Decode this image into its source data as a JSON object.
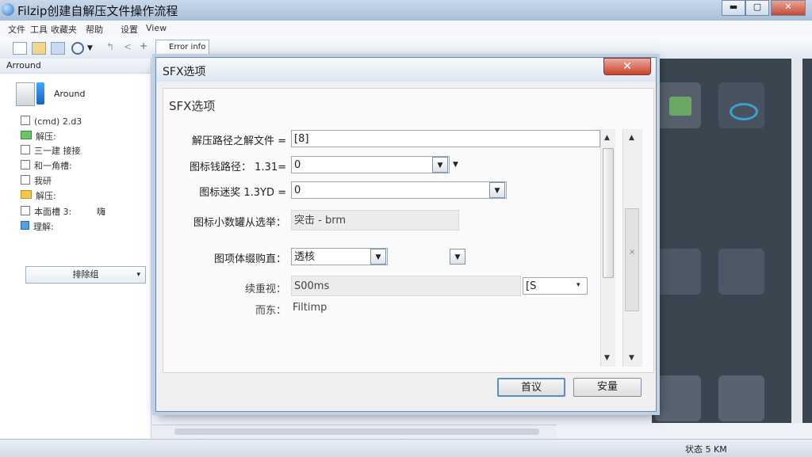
{
  "app": {
    "title": "Filzip创建自解压文件操作流程",
    "win_minimize": "▬",
    "win_maximize": "▢",
    "win_close": "✕"
  },
  "menu": [
    "文件",
    "工具",
    "收藏夹",
    "帮助",
    "设置",
    "View"
  ],
  "toolbar": {
    "info_label": "Error info"
  },
  "left_panel": {
    "header": "Arround",
    "drive_label": "Around",
    "tree": [
      {
        "label": "(cmd) 2.d3",
        "kind": "box"
      },
      {
        "label": "解压:",
        "kind": "folder"
      },
      {
        "label": "三一建 接接",
        "kind": "box"
      },
      {
        "label": "和一角槽:",
        "kind": "box"
      },
      {
        "label": "我研",
        "kind": "box"
      },
      {
        "label": "解压:",
        "kind": "folder"
      },
      {
        "label": "本面槽  3:",
        "kind": "box"
      },
      {
        "label": "理解:",
        "kind": "doc"
      }
    ],
    "tree_extra": "嗨",
    "combo_label": "排除组"
  },
  "status_bar": {
    "text": "状态 5 KM"
  },
  "dialog": {
    "title": "SFX选项",
    "close_label": "✕",
    "group_title": "SFX选项",
    "fields": {
      "extract_path": {
        "label": "解压路径之解文件 =",
        "value": "[8]"
      },
      "icon_shortcut": {
        "label": "图标钱路径： 1.31=",
        "value": "0"
      },
      "icon_link": {
        "label": "图标迷奖 1.3YD =",
        "value": "0"
      },
      "icon_select": {
        "label": "图标小数罐从选举：",
        "value": "突击 - brm"
      },
      "icon_layout": {
        "label": "图项体缀购直：",
        "value": "透核"
      },
      "title_text": {
        "label": "续重视：",
        "value": "S00ms",
        "unit": "[S"
      },
      "company": {
        "label": "而东：",
        "value": "Filtimp"
      }
    },
    "ok_button": "首议",
    "cancel_button": "安量"
  }
}
